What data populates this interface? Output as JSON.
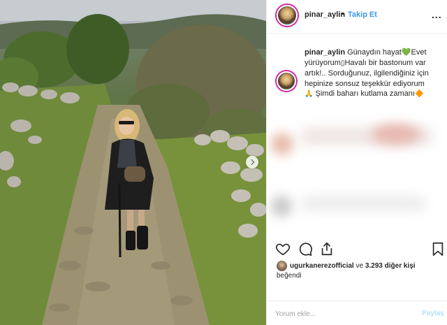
{
  "header": {
    "username": "pinar_aylin",
    "separator": "•",
    "follow_label": "Takip Et",
    "more_label": "..."
  },
  "caption": {
    "username": "pinar_aylin",
    "part1": " Günaydın hayat",
    "part2": "Evet yürüyorum",
    "part3": "Havalı bir bastonum var artık!.. Sorduğunuz, ilgilendiğiniz için hepinize sonsuz teşekkür ediyorum",
    "part4": " Şimdi baharı kutlama zamanı",
    "heart_emoji": "💚",
    "box_glyph": "▯",
    "pray_emoji": "🙏",
    "sunflower_emoji": "🔶"
  },
  "likes": {
    "liker": "ugurkanerezofficial",
    "connector": " ve ",
    "count_text": "3.293 diğer kişi",
    "liked_label": "beğendi"
  },
  "comment": {
    "placeholder": "Yorum ekle...",
    "share_label": "Paylaş"
  },
  "icons": {
    "like": "heart-outline-icon",
    "comment": "speech-bubble-icon",
    "share": "share-icon",
    "save": "bookmark-icon",
    "carousel": "chevron-right-icon"
  },
  "colors": {
    "follow": "#3897f0",
    "heart": "#34c138",
    "share_disabled": "#b2dffc"
  }
}
